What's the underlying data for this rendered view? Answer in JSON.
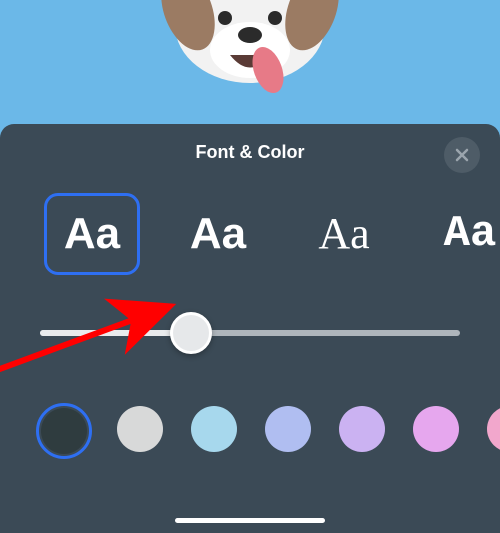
{
  "panel": {
    "title": "Font & Color",
    "close_icon": "close"
  },
  "fonts": {
    "glyph": "Aa",
    "options": [
      {
        "name": "sans",
        "selected": true
      },
      {
        "name": "rounded",
        "selected": false
      },
      {
        "name": "serif",
        "selected": false
      },
      {
        "name": "slab",
        "selected": false
      }
    ]
  },
  "size_slider": {
    "percent": 36
  },
  "colors": {
    "options": [
      {
        "hex": "#2f3c3f",
        "selected": true
      },
      {
        "hex": "#d8d9d9",
        "selected": false
      },
      {
        "hex": "#a7d8ed",
        "selected": false
      },
      {
        "hex": "#b0bef1",
        "selected": false
      },
      {
        "hex": "#cbb2f2",
        "selected": false
      },
      {
        "hex": "#e6a7ee",
        "selected": false
      },
      {
        "hex": "#f2a7cc",
        "selected": false
      }
    ]
  },
  "annotation": {
    "type": "arrow",
    "color": "#ff0000"
  }
}
